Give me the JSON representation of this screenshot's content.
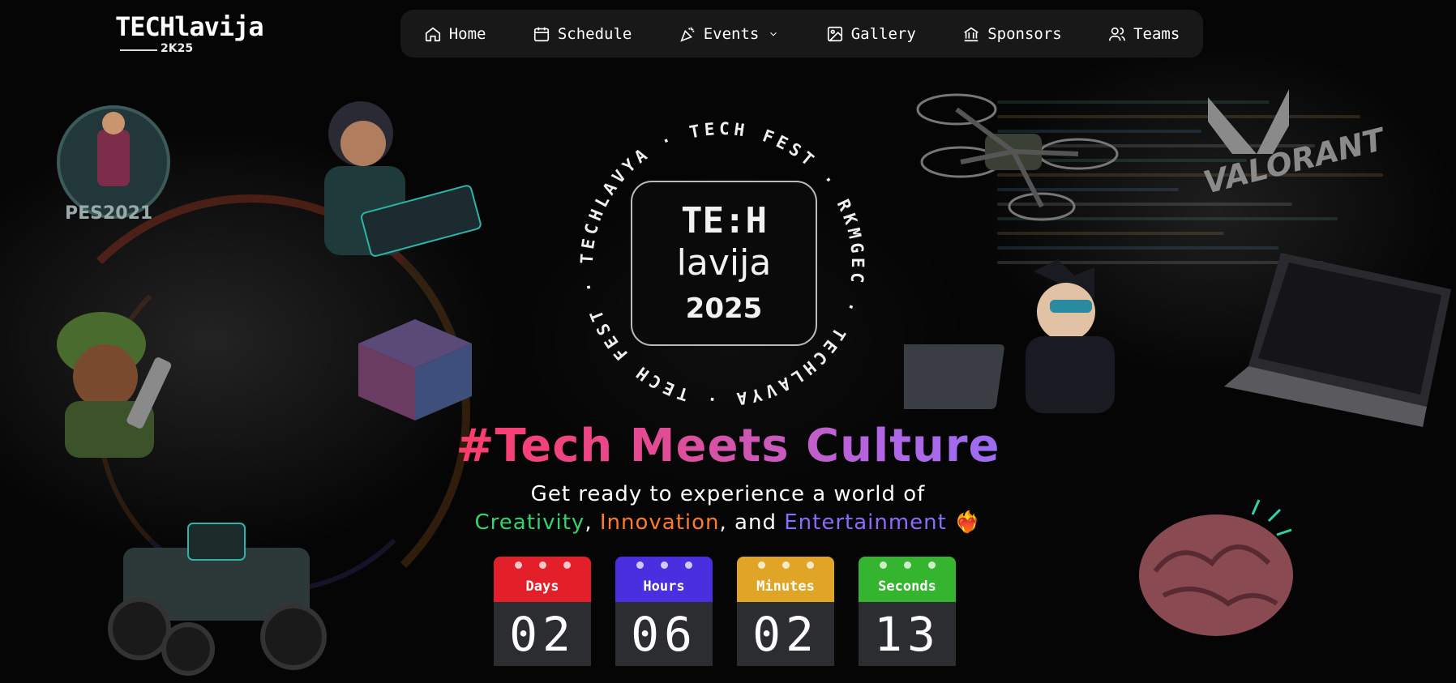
{
  "brand": {
    "logo_text": "TECHlavija",
    "logo_subtext": "2K25"
  },
  "nav": {
    "items": [
      {
        "label": "Home",
        "icon": "home-icon"
      },
      {
        "label": "Schedule",
        "icon": "calendar-icon"
      },
      {
        "label": "Events",
        "icon": "party-popper-icon"
      },
      {
        "label": "Gallery",
        "icon": "gallery-icon"
      },
      {
        "label": "Sponsors",
        "icon": "bank-icon"
      },
      {
        "label": "Teams",
        "icon": "users-icon"
      }
    ]
  },
  "emblem": {
    "ring_text": "TECHLAVYA · TECH FEST · RKMGEC · TECHLAVYA · TECH FEST · RKMGEC ·",
    "line1": "TE:H",
    "line2": "lavija",
    "year": "2025"
  },
  "hero": {
    "tagline": "#Tech Meets Culture",
    "subtitle_line1": "Get ready to experience a world of",
    "word_creativity": "Creativity",
    "sep1": ", ",
    "word_innovation": "Innovation",
    "sep2": ", and ",
    "word_entertainment": "Entertainment",
    "emoji": "❤️‍🔥"
  },
  "countdown": {
    "days": {
      "label": "Days",
      "value": "02",
      "color": "#e3202a"
    },
    "hours": {
      "label": "Hours",
      "value": "06",
      "color": "#4a2fe0"
    },
    "minutes": {
      "label": "Minutes",
      "value": "02",
      "color": "#e0a426"
    },
    "seconds": {
      "label": "Seconds",
      "value": "13",
      "color": "#35b52f"
    }
  },
  "decor": {
    "valorant_text": "VALORANT",
    "pes_text": "PES2021"
  }
}
